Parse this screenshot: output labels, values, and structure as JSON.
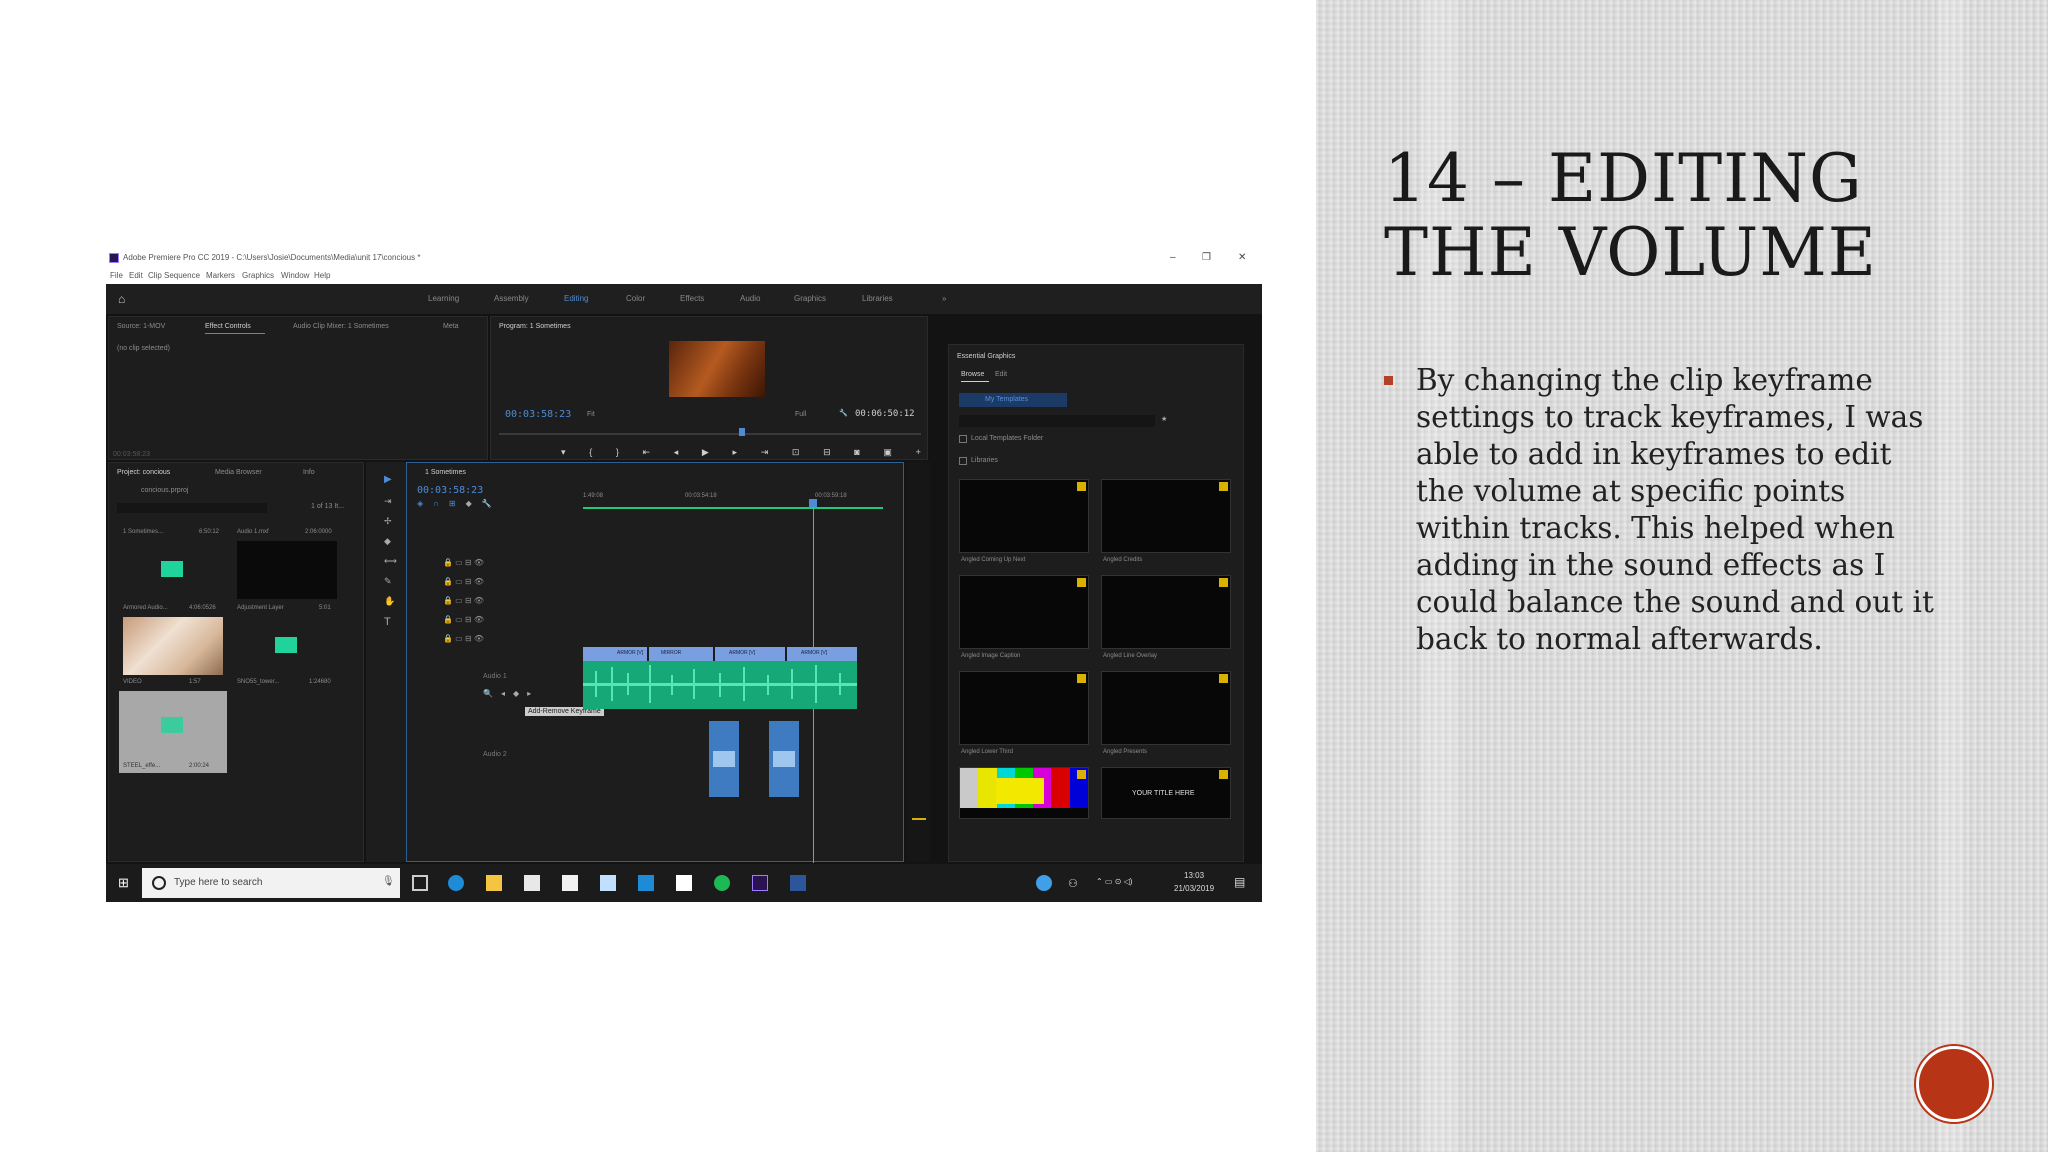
{
  "slide": {
    "title_line1": "14 – EDITING",
    "title_line2": "THE VOLUME",
    "bullet": "By changing the clip keyframe settings to track keyframes, I was able to add in keyframes to edit the volume at specific points within tracks. This helped when adding in the sound effects as I could balance the sound and out it back to normal afterwards.",
    "accent_color": "#b2402a"
  },
  "screenshot": {
    "window_title": "Adobe Premiere Pro CC 2019 - C:\\Users\\Josie\\Documents\\Media\\unit 17\\concious *",
    "menu": [
      "File",
      "Edit",
      "Clip",
      "Sequence",
      "Markers",
      "Graphics",
      "Window",
      "Help"
    ],
    "workspaces": [
      "Learning",
      "Assembly",
      "Editing",
      "Color",
      "Effects",
      "Audio",
      "Graphics",
      "Libraries"
    ],
    "active_workspace": "Editing",
    "source_panel_tabs": [
      "Source: 1-MOV",
      "Effect Controls",
      "Audio Clip Mixer: 1 Sometimes",
      "Meta"
    ],
    "effect_controls_msg": "(no clip selected)",
    "effect_controls_tc": "00:03:58:23",
    "program_title": "Program: 1 Sometimes",
    "program_tc": "00:03:58:23",
    "program_fit": "Fit",
    "program_full": "Full",
    "program_duration": "00:06:50:12",
    "project_tabs": [
      "Project: concious",
      "Media Browser",
      "Info"
    ],
    "project_file": "concious.prproj",
    "project_count": "1 of 13 It...",
    "project_items": [
      {
        "name": "1 Sometimes...",
        "dur": "6:50:12"
      },
      {
        "name": "Audio 1.mxf",
        "dur": "2:06:0000"
      },
      {
        "name": "Armored Audio...",
        "dur": "4:06:0526"
      },
      {
        "name": "Adjustment Layer",
        "dur": "5:01"
      },
      {
        "name": "VIDEO",
        "dur": "1:57"
      },
      {
        "name": "SNO55_tower...",
        "dur": "1:24680"
      },
      {
        "name": "STEEL_effe...",
        "dur": "2:00:24"
      }
    ],
    "timeline_tab": "1 Sometimes",
    "timeline_tc": "00:03:58:23",
    "ruler": [
      "1:49:08",
      "00:03:54:18",
      "00:03:59:18"
    ],
    "clip_labels": [
      "ARMOR [V]",
      "MIRROR",
      "ARMOR [V]",
      "ARMOR [V]"
    ],
    "audio_track_label": "Audio 1",
    "audio2_label": "Audio 2",
    "tooltip": "Add-Remove Keyframe",
    "essential_graphics": "Essential Graphics",
    "eg_tabs": [
      "Browse",
      "Edit"
    ],
    "eg_dropdown": "My Templates",
    "eg_local": "Local Templates Folder",
    "eg_libraries": "Libraries",
    "templates": [
      "Angled Coming Up Next",
      "Angled Credits",
      "Angled Image Caption",
      "Angled Line Overlay",
      "Angled Lower Third",
      "Angled Presents",
      "",
      "YOUR TITLE HERE"
    ],
    "taskbar_search": "Type here to search",
    "clock_time": "13:03",
    "clock_date": "21/03/2019"
  }
}
